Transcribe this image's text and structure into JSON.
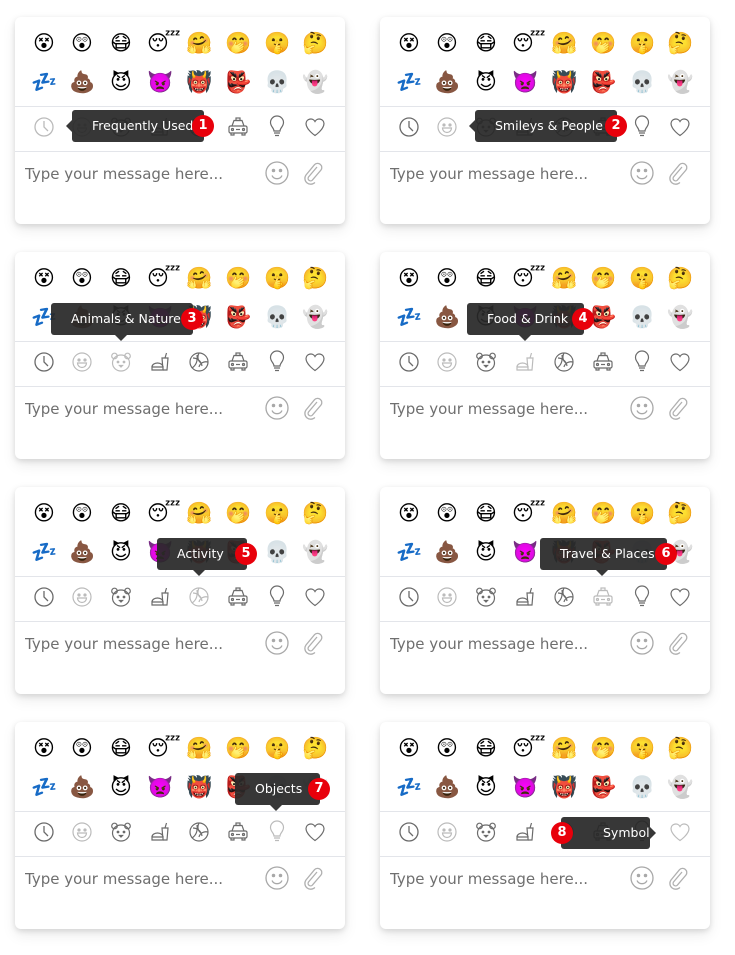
{
  "emoji_rows": [
    [
      "😵",
      "😲",
      "😷",
      "😴",
      "🤗",
      "🤭",
      "🤫",
      "🤔"
    ],
    [
      "💤",
      "💩",
      "😈",
      "👿",
      "👹",
      "👺",
      "💀",
      "👻"
    ]
  ],
  "emoji_names": [
    [
      "dizzy-face",
      "astonished-face",
      "face-with-mask",
      "sleeping-face",
      "hugging-face",
      "hand-over-mouth-face",
      "shushing-face",
      "thinking-face"
    ],
    [
      "zzz",
      "pile-of-poo",
      "smiling-devil",
      "angry-devil",
      "ogre",
      "goblin",
      "skull",
      "ghost"
    ]
  ],
  "tabs": [
    {
      "name": "clock",
      "label": "Frequently Used"
    },
    {
      "name": "smiley",
      "label": "Smileys & People"
    },
    {
      "name": "bear",
      "label": "Animals & Nature"
    },
    {
      "name": "food",
      "label": "Food & Drink"
    },
    {
      "name": "ball",
      "label": "Activity"
    },
    {
      "name": "taxi",
      "label": "Travel & Places"
    },
    {
      "name": "bulb",
      "label": "Objects"
    },
    {
      "name": "heart",
      "label": "Symbols"
    }
  ],
  "input": {
    "placeholder": "Type your message here..."
  },
  "panels": [
    {
      "step": "1",
      "tooltip": "Frequently Used",
      "hovered_tab": 0
    },
    {
      "step": "2",
      "tooltip": "Smileys & People",
      "hovered_tab": 1
    },
    {
      "step": "3",
      "tooltip": "Animals & Nature",
      "hovered_tab": 2
    },
    {
      "step": "4",
      "tooltip": "Food & Drink",
      "hovered_tab": 3
    },
    {
      "step": "5",
      "tooltip": "Activity",
      "hovered_tab": 4
    },
    {
      "step": "6",
      "tooltip": "Travel & Places",
      "hovered_tab": 5
    },
    {
      "step": "7",
      "tooltip": "Objects",
      "hovered_tab": 6
    },
    {
      "step": "8",
      "tooltip": "Symbols",
      "hovered_tab": 7
    }
  ],
  "colors": {
    "badge": "#e8000b",
    "tooltip_bg": "#282828",
    "icon_stroke": "#6b6b6b",
    "divider": "#e3e5ea"
  }
}
